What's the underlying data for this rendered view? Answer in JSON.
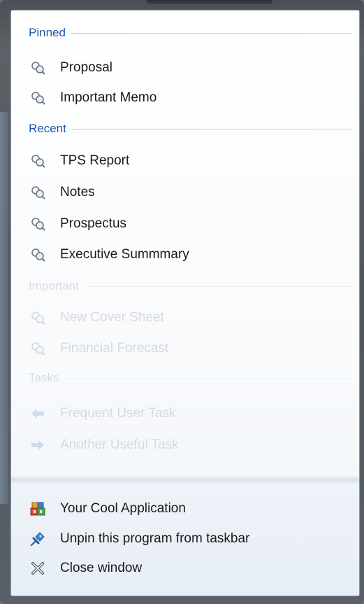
{
  "sections": {
    "pinned": {
      "title": "Pinned",
      "items": [
        {
          "label": "Proposal",
          "icon": "document-search-icon"
        },
        {
          "label": "Important Memo",
          "icon": "document-search-icon"
        }
      ]
    },
    "recent": {
      "title": "Recent",
      "items": [
        {
          "label": "TPS Report",
          "icon": "document-search-icon"
        },
        {
          "label": "Notes",
          "icon": "document-search-icon"
        },
        {
          "label": "Prospectus",
          "icon": "document-search-icon"
        },
        {
          "label": "Executive Summmary",
          "icon": "document-search-icon"
        }
      ]
    },
    "important": {
      "title": "Important",
      "items": [
        {
          "label": "New Cover Sheet",
          "icon": "document-search-icon"
        },
        {
          "label": "Financial Forecast",
          "icon": "document-search-icon"
        }
      ]
    },
    "tasks": {
      "title": "Tasks",
      "items": [
        {
          "label": "Frequent User Task",
          "icon": "arrow-left-icon"
        },
        {
          "label": "Another Useful Task",
          "icon": "arrow-right-icon"
        }
      ]
    }
  },
  "footer": {
    "items": [
      {
        "label": "Your Cool Application",
        "icon": "app-icon"
      },
      {
        "label": "Unpin this program from taskbar",
        "icon": "unpin-icon"
      },
      {
        "label": "Close window",
        "icon": "close-icon"
      }
    ]
  },
  "colors": {
    "section_title": "#1e5aa8",
    "disabled_text": "#d6dadf",
    "item_text": "#1a1a1a"
  }
}
